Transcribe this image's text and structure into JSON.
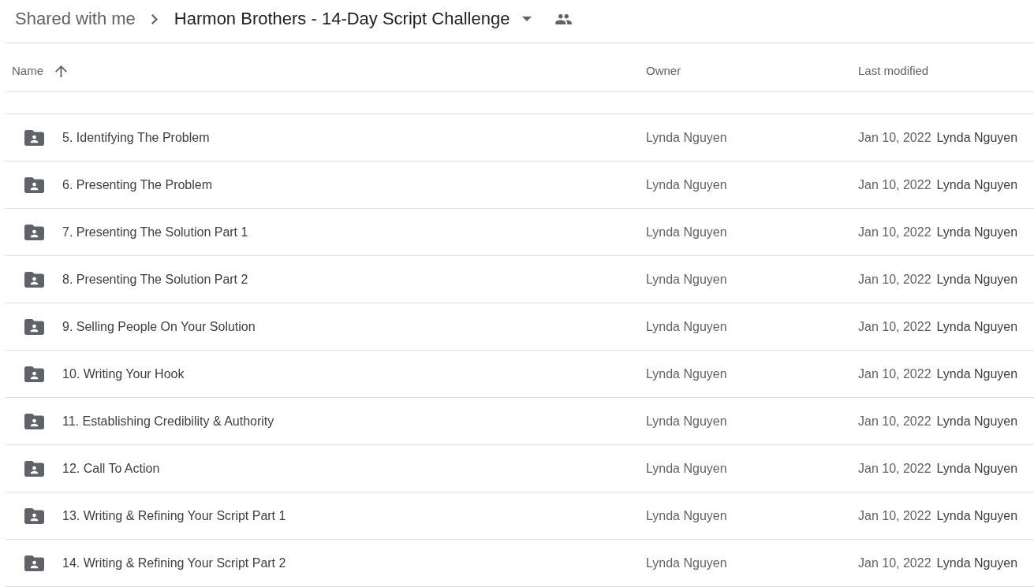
{
  "breadcrumb": [
    {
      "label": "Shared with me",
      "current": false
    },
    {
      "label": "Harmon Brothers - 14-Day Script Challenge",
      "current": true
    }
  ],
  "table": {
    "columns": [
      {
        "label": "Name",
        "sorted": true,
        "ascending": true
      },
      {
        "label": "Owner",
        "sorted": false
      },
      {
        "label": "Last modified",
        "sorted": false
      }
    ],
    "rows": [
      {
        "name": "5. Identifying The Problem",
        "owner": "Lynda Nguyen",
        "modified_date": "Jan 10, 2022",
        "modified_by": "Lynda Nguyen"
      },
      {
        "name": "6. Presenting The Problem",
        "owner": "Lynda Nguyen",
        "modified_date": "Jan 10, 2022",
        "modified_by": "Lynda Nguyen"
      },
      {
        "name": "7. Presenting The Solution Part 1",
        "owner": "Lynda Nguyen",
        "modified_date": "Jan 10, 2022",
        "modified_by": "Lynda Nguyen"
      },
      {
        "name": "8. Presenting The Solution Part 2",
        "owner": "Lynda Nguyen",
        "modified_date": "Jan 10, 2022",
        "modified_by": "Lynda Nguyen"
      },
      {
        "name": "9. Selling People On Your Solution",
        "owner": "Lynda Nguyen",
        "modified_date": "Jan 10, 2022",
        "modified_by": "Lynda Nguyen"
      },
      {
        "name": "10. Writing Your Hook",
        "owner": "Lynda Nguyen",
        "modified_date": "Jan 10, 2022",
        "modified_by": "Lynda Nguyen"
      },
      {
        "name": "11. Establishing Credibility & Authority",
        "owner": "Lynda Nguyen",
        "modified_date": "Jan 10, 2022",
        "modified_by": "Lynda Nguyen"
      },
      {
        "name": "12. Call To Action",
        "owner": "Lynda Nguyen",
        "modified_date": "Jan 10, 2022",
        "modified_by": "Lynda Nguyen"
      },
      {
        "name": "13. Writing & Refining Your Script Part 1",
        "owner": "Lynda Nguyen",
        "modified_date": "Jan 10, 2022",
        "modified_by": "Lynda Nguyen"
      },
      {
        "name": "14. Writing & Refining Your Script Part 2",
        "owner": "Lynda Nguyen",
        "modified_date": "Jan 10, 2022",
        "modified_by": "Lynda Nguyen"
      }
    ]
  }
}
